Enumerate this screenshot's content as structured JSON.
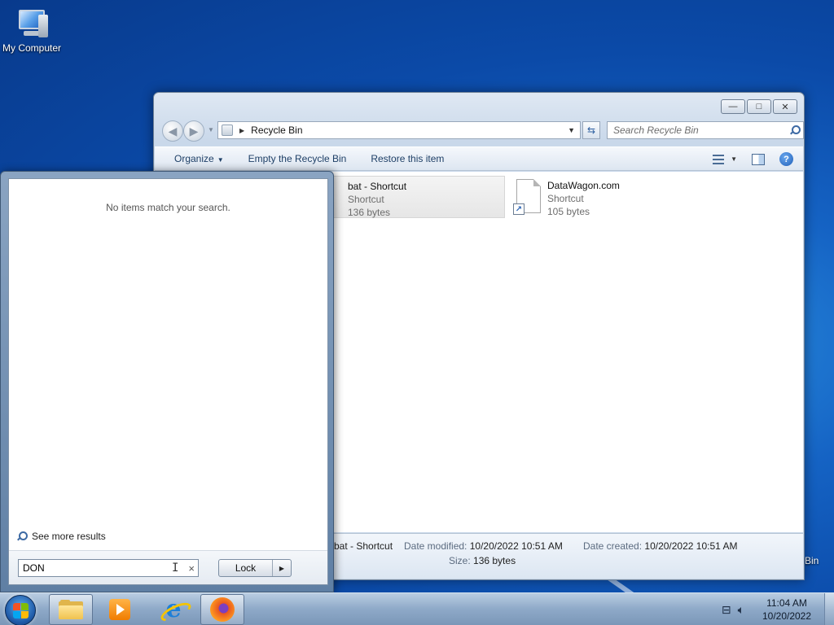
{
  "desktop": {
    "icons": [
      {
        "label": "My Computer"
      }
    ],
    "partial_label": "Bin"
  },
  "explorer": {
    "window_buttons": {
      "minimize": "—",
      "maximize": "□",
      "close": "✕"
    },
    "address": {
      "location": "Recycle Bin"
    },
    "search": {
      "placeholder": "Search Recycle Bin"
    },
    "commands": {
      "organize": "Organize",
      "empty": "Empty the Recycle Bin",
      "restore": "Restore this item"
    },
    "files": [
      {
        "name": "bat - Shortcut",
        "type": "Shortcut",
        "size": "136 bytes",
        "selected": true
      },
      {
        "name": "DataWagon.com",
        "type": "Shortcut",
        "size": "105 bytes",
        "selected": false
      }
    ],
    "details": {
      "name": "bat - Shortcut",
      "modified_label": "Date modified:",
      "modified_value": "10/20/2022 10:51 AM",
      "created_label": "Date created:",
      "created_value": "10/20/2022 10:51 AM",
      "size_label": "Size:",
      "size_value": "136 bytes"
    }
  },
  "startmenu": {
    "no_results": "No items match your search.",
    "see_more": "See more results",
    "search_value": "DON",
    "clear": "×",
    "power_button": "Lock"
  },
  "taskbar": {
    "clock_time": "11:04 AM",
    "clock_date": "10/20/2022"
  }
}
